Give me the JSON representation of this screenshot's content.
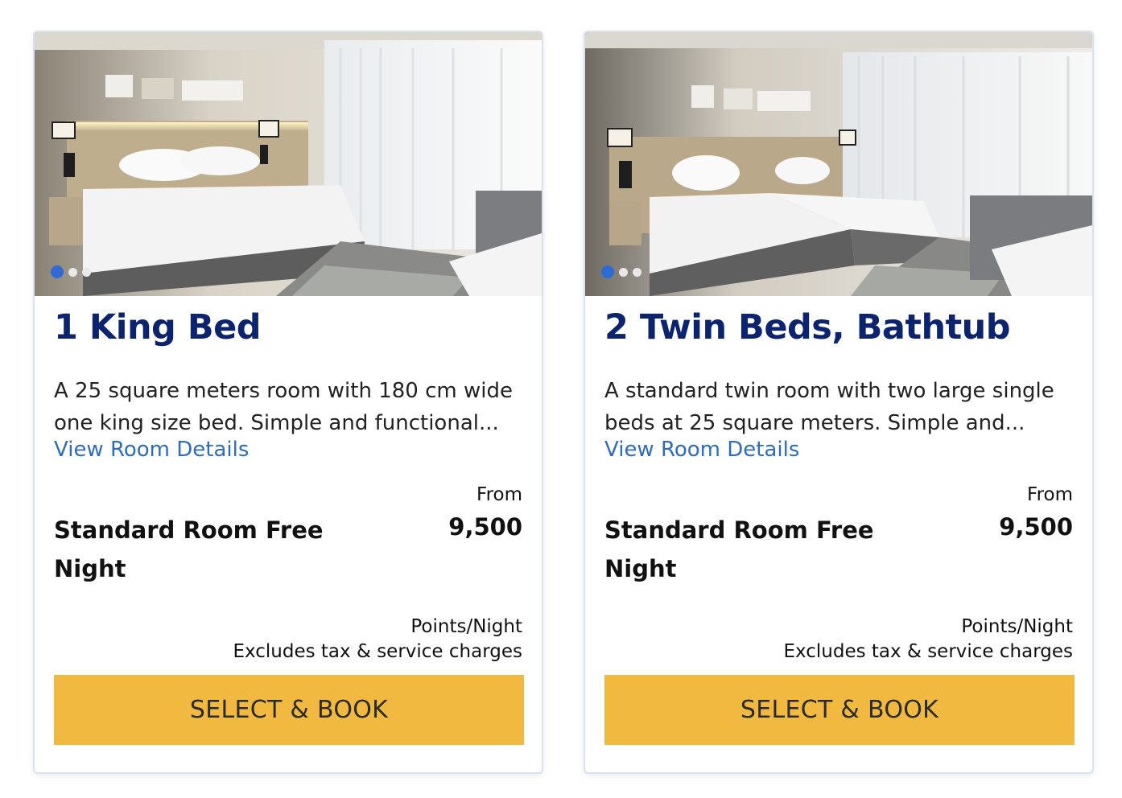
{
  "colors": {
    "title": "#0c2470",
    "link": "#2d6cc0",
    "button_bg": "#f2b940",
    "dot_active": "#2e6bd4",
    "card_border": "#d9e2ee"
  },
  "rooms": [
    {
      "image": "photo of hotel room with one king bed, sofa and window",
      "carousel": {
        "count": 3,
        "active": 1
      },
      "title": "1 King Bed",
      "description": "A 25 square meters room with 180 cm wide one king size bed. Simple and functional...",
      "details_link": "View Room Details",
      "rate_name": "Standard Room Free Night",
      "from_label": "From",
      "points": "9,500",
      "points_unit": "Points/Night",
      "tax_note": "Excludes tax & service charges",
      "button_label": "SELECT & BOOK"
    },
    {
      "image": "photo of hotel room with two twin beds, sofa and window",
      "carousel": {
        "count": 3,
        "active": 1
      },
      "title": "2 Twin Beds, Bathtub",
      "description": "A standard twin room with two large single beds at 25 square meters. Simple and...",
      "details_link": "View Room Details",
      "rate_name": "Standard Room Free Night",
      "from_label": "From",
      "points": "9,500",
      "points_unit": "Points/Night",
      "tax_note": "Excludes tax & service charges",
      "button_label": "SELECT & BOOK"
    }
  ]
}
